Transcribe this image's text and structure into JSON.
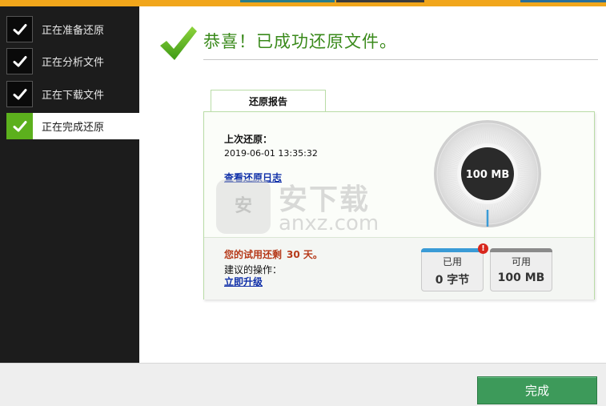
{
  "steps": [
    {
      "label": "正在准备还原",
      "state": "done"
    },
    {
      "label": "正在分析文件",
      "state": "done"
    },
    {
      "label": "正在下载文件",
      "state": "done"
    },
    {
      "label": "正在完成还原",
      "state": "active"
    }
  ],
  "heading": {
    "title": "恭喜！已成功还原文件。"
  },
  "report": {
    "tab_label": "还原报告",
    "last_restore_label": "上次还原：",
    "last_restore_date": "2019-06-01 13:35:32",
    "view_log_link": "查看还原日志",
    "gauge_value": "100 MB",
    "trial_prefix": "您的试用还剩",
    "trial_days": "30 天。",
    "suggest_label": "建议的操作：",
    "upgrade_link": "立即升级",
    "used": {
      "caption": "已用",
      "value": "0 字节"
    },
    "available": {
      "caption": "可用",
      "value": "100 MB"
    },
    "alert_symbol": "!"
  },
  "watermark": {
    "badge": "安",
    "text_cn": "安下载",
    "text_en": "anxz.com"
  },
  "footer": {
    "finish_label": "完成"
  },
  "colors": {
    "accent_green": "#3a8a1b",
    "sidebar_bg": "#1c1c1c",
    "finish_bg": "#3d9a5a",
    "link_blue": "#0f2fa8",
    "trial_red": "#b63a1a"
  },
  "icons": {
    "step_done": "check-icon",
    "heading": "large-check-icon",
    "alert": "alert-icon"
  }
}
